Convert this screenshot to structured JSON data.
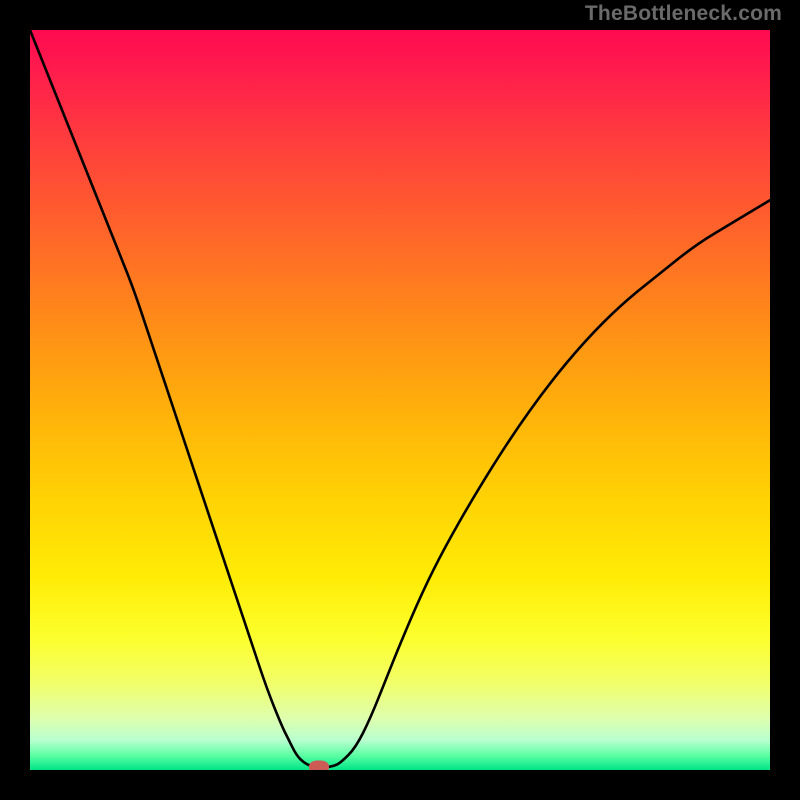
{
  "watermark": "TheBottleneck.com",
  "colors": {
    "frame": "#000000",
    "curve": "#000000",
    "marker": "#cc5a55"
  },
  "chart_data": {
    "type": "line",
    "title": "",
    "xlabel": "",
    "ylabel": "",
    "xlim": [
      0,
      100
    ],
    "ylim": [
      0,
      100
    ],
    "grid": false,
    "series": [
      {
        "name": "bottleneck-curve",
        "x": [
          0,
          2,
          4,
          6,
          8,
          10,
          12,
          14,
          16,
          18,
          20,
          22,
          24,
          26,
          28,
          30,
          32,
          34,
          35,
          36,
          37,
          38,
          39,
          40,
          41,
          42,
          44,
          46,
          48,
          50,
          53,
          56,
          60,
          65,
          70,
          75,
          80,
          85,
          90,
          95,
          100
        ],
        "y": [
          100,
          95,
          90,
          85,
          80,
          75,
          70,
          65,
          59,
          53,
          47,
          41,
          35,
          29,
          23,
          17,
          11,
          6,
          4,
          2,
          1,
          0.5,
          0.4,
          0.4,
          0.5,
          1,
          3,
          7,
          12,
          17,
          24,
          30,
          37,
          45,
          52,
          58,
          63,
          67,
          71,
          74,
          77
        ]
      }
    ],
    "marker": {
      "x": 39,
      "y": 0.4
    },
    "flat_bottom": {
      "x_start": 37,
      "x_end": 41
    },
    "gradient_stops": [
      {
        "pct": 0,
        "color": "#ff0a50"
      },
      {
        "pct": 24,
        "color": "#ff5a2f"
      },
      {
        "pct": 54,
        "color": "#ffb808"
      },
      {
        "pct": 82,
        "color": "#fcff2c"
      },
      {
        "pct": 96,
        "color": "#b8ffcf"
      },
      {
        "pct": 100,
        "color": "#00e487"
      }
    ]
  }
}
